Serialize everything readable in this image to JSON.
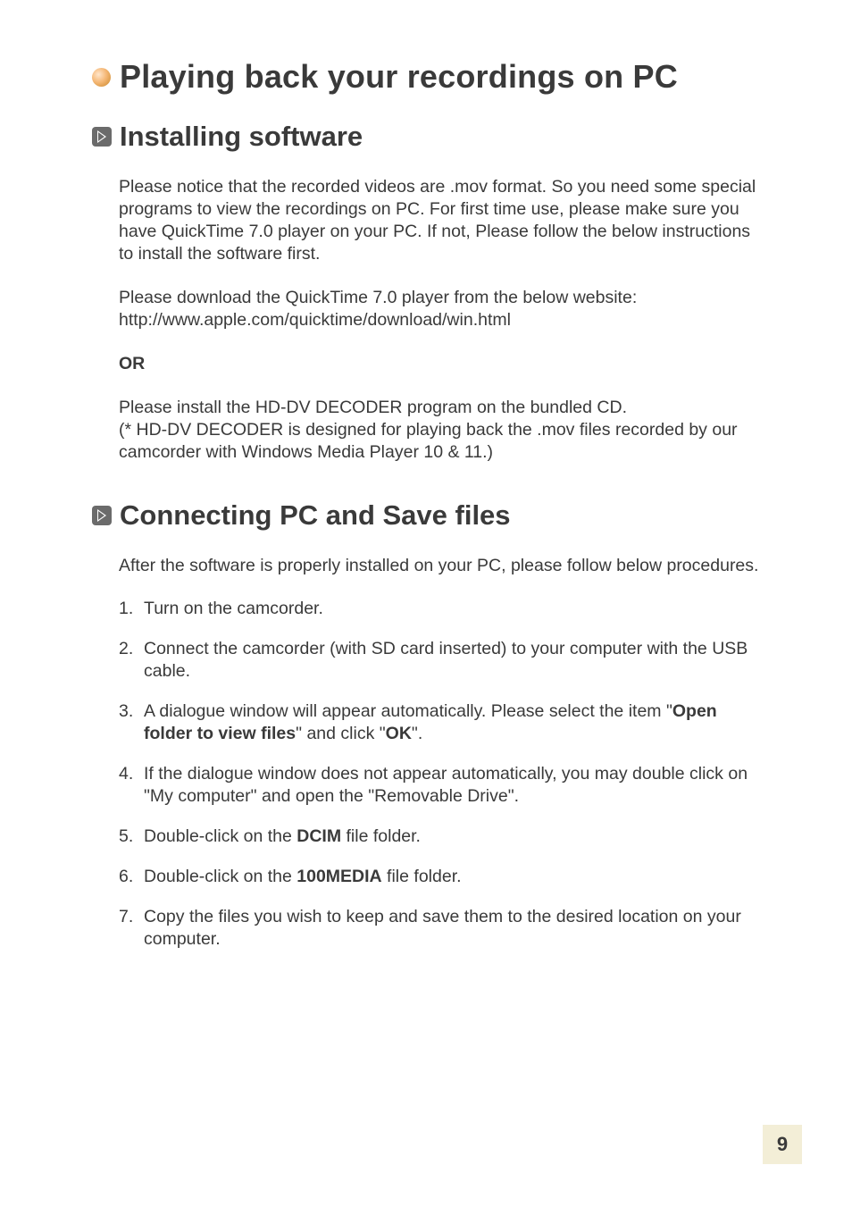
{
  "title": "Playing back your recordings on PC",
  "sections": {
    "installing": {
      "heading": "Installing software",
      "p1": "Please notice that the recorded videos are .mov format. So you need some special programs to view the recordings on PC. For first time use, please make sure you have QuickTime 7.0 player on your PC. If not, Please follow the below instructions to install the software first.",
      "p2a": "Please download the QuickTime 7.0 player from the below website:",
      "p2b": "http://www.apple.com/quicktime/download/win.html",
      "or": "OR",
      "p3a": "Please install the HD-DV DECODER program on the bundled CD.",
      "p3b": "(* HD-DV DECODER is designed for playing back the .mov files recorded by our camcorder with Windows Media Player 10 & 11.)"
    },
    "connecting": {
      "heading": "Connecting PC and Save files",
      "intro": "After the software is properly installed on your PC, please follow below procedures.",
      "steps": {
        "s1": "Turn on the camcorder.",
        "s2": "Connect the camcorder (with SD card inserted) to your computer with the USB cable.",
        "s3_a": "A dialogue window will appear automatically. Please select the item \"",
        "s3_b1": "Open folder to view files",
        "s3_c": "\" and click \"",
        "s3_b2": "OK",
        "s3_d": "\".",
        "s4": "If the dialogue window does not appear automatically, you may double click on \"My computer\" and open the \"Removable Drive\".",
        "s5_a": "Double-click on the ",
        "s5_b": "DCIM",
        "s5_c": " file folder.",
        "s6_a": "Double-click on the ",
        "s6_b": "100MEDIA",
        "s6_c": " file folder.",
        "s7": "Copy the files you wish to keep and save them to the desired location on your computer."
      }
    }
  },
  "page_number": "9"
}
